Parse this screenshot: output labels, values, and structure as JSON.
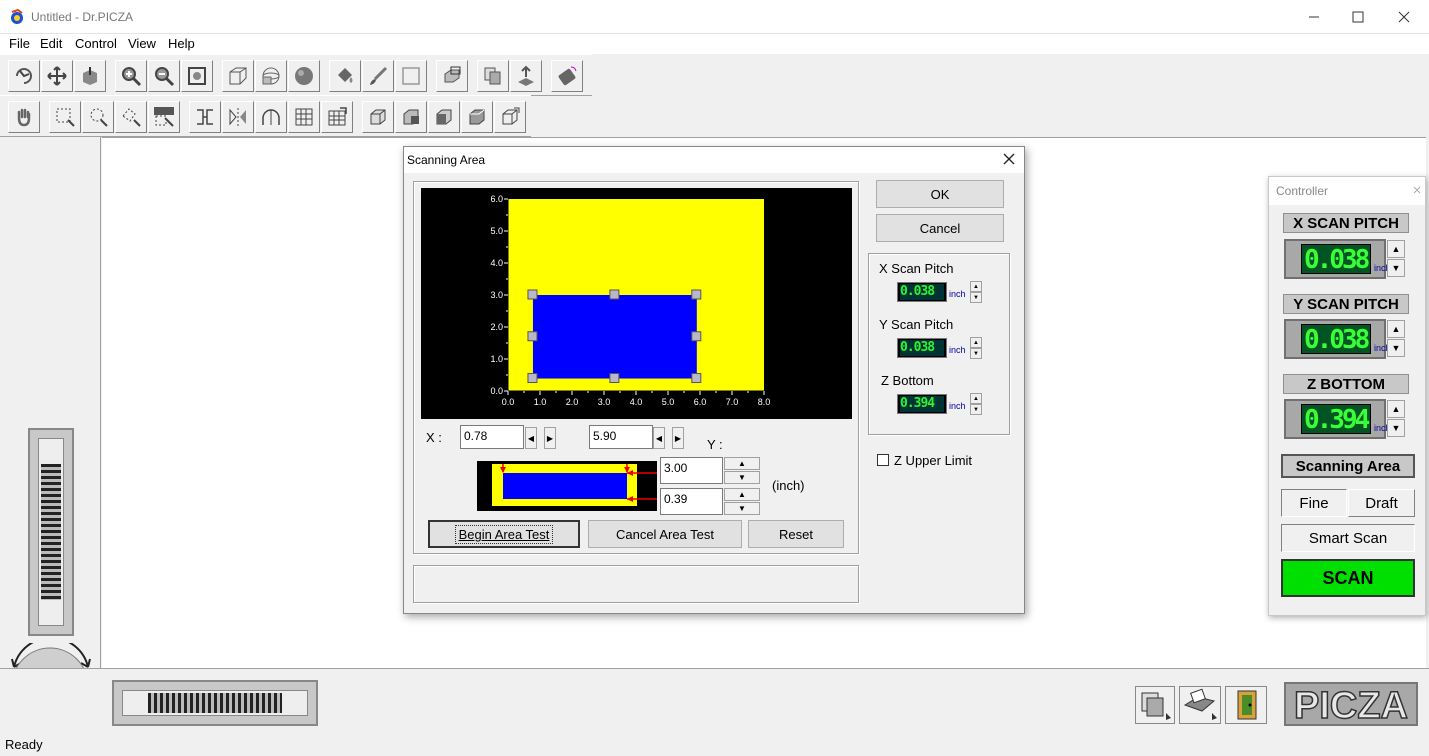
{
  "window": {
    "title": "Untitled - Dr.PICZA"
  },
  "menu": [
    "File",
    "Edit",
    "Control",
    "View",
    "Help"
  ],
  "status": {
    "text": "Ready"
  },
  "dialog": {
    "title": "Scanning Area",
    "ok_label": "OK",
    "cancel_label": "Cancel",
    "x_scan_pitch_label": "X Scan Pitch",
    "x_scan_pitch_value": "0.038",
    "y_scan_pitch_label": "Y Scan Pitch",
    "y_scan_pitch_value": "0.038",
    "z_bottom_label": "Z Bottom",
    "z_bottom_value": "0.394",
    "unit_small": "inch",
    "z_upper_limit_label": "Z Upper Limit",
    "x_label": "X :",
    "y_label": "Y :",
    "x_min": "0.78",
    "x_max": "5.90",
    "y_max": "3.00",
    "y_min": "0.39",
    "unit_label": "(inch)",
    "begin_area_test_label": "Begin Area Test",
    "cancel_area_test_label": "Cancel Area Test",
    "reset_label": "Reset",
    "preview": {
      "x_ticks": [
        "0.0",
        "1.0",
        "2.0",
        "3.0",
        "4.0",
        "5.0",
        "6.0",
        "7.0",
        "8.0"
      ],
      "y_ticks": [
        "0.0",
        "1.0",
        "2.0",
        "3.0",
        "4.0",
        "5.0",
        "6.0"
      ],
      "x_range": [
        0,
        8
      ],
      "y_range": [
        0,
        6
      ],
      "table_width": 8,
      "table_height": 6,
      "scan_area": {
        "x_min": 0.78,
        "x_max": 5.9,
        "y_min": 0.39,
        "y_max": 3.0
      },
      "table_color": "#ffff00",
      "scan_color": "#0000ff"
    }
  },
  "controller": {
    "title": "Controller",
    "x_scan_pitch_label": "X SCAN PITCH",
    "x_scan_pitch_value": "0.038",
    "y_scan_pitch_label": "Y SCAN PITCH",
    "y_scan_pitch_value": "0.038",
    "z_bottom_label": "Z BOTTOM",
    "z_bottom_value": "0.394",
    "unit": "inch",
    "scanning_area_label": "Scanning Area",
    "fine_label": "Fine",
    "draft_label": "Draft",
    "smart_scan_label": "Smart Scan",
    "scan_label": "SCAN",
    "scan_color": "#00e000"
  },
  "logo_text": "PICZA",
  "toolbar1_icons": [
    "rotate-object-icon",
    "move-icon",
    "axis-icon",
    "zoom-in-icon",
    "zoom-out-icon",
    "zoom-fit-icon",
    "wireframe-icon",
    "mesh-icon",
    "shaded-icon",
    "paint-bucket-icon",
    "brush-icon",
    "square-icon",
    "frame-cube-icon",
    "copy-layers-icon",
    "scan-layers-icon",
    "remote-control-icon"
  ],
  "toolbar2_icons": [
    "hand-icon",
    "select-rectangle-icon",
    "select-lasso-icon",
    "select-polygon-icon",
    "scan-select-icon",
    "measure-icon",
    "mirror-icon",
    "arch-icon",
    "grid-icon",
    "grid-edit-icon",
    "box-1-icon",
    "box-2-icon",
    "box-3-icon",
    "box-4-icon",
    "box-5-icon"
  ]
}
